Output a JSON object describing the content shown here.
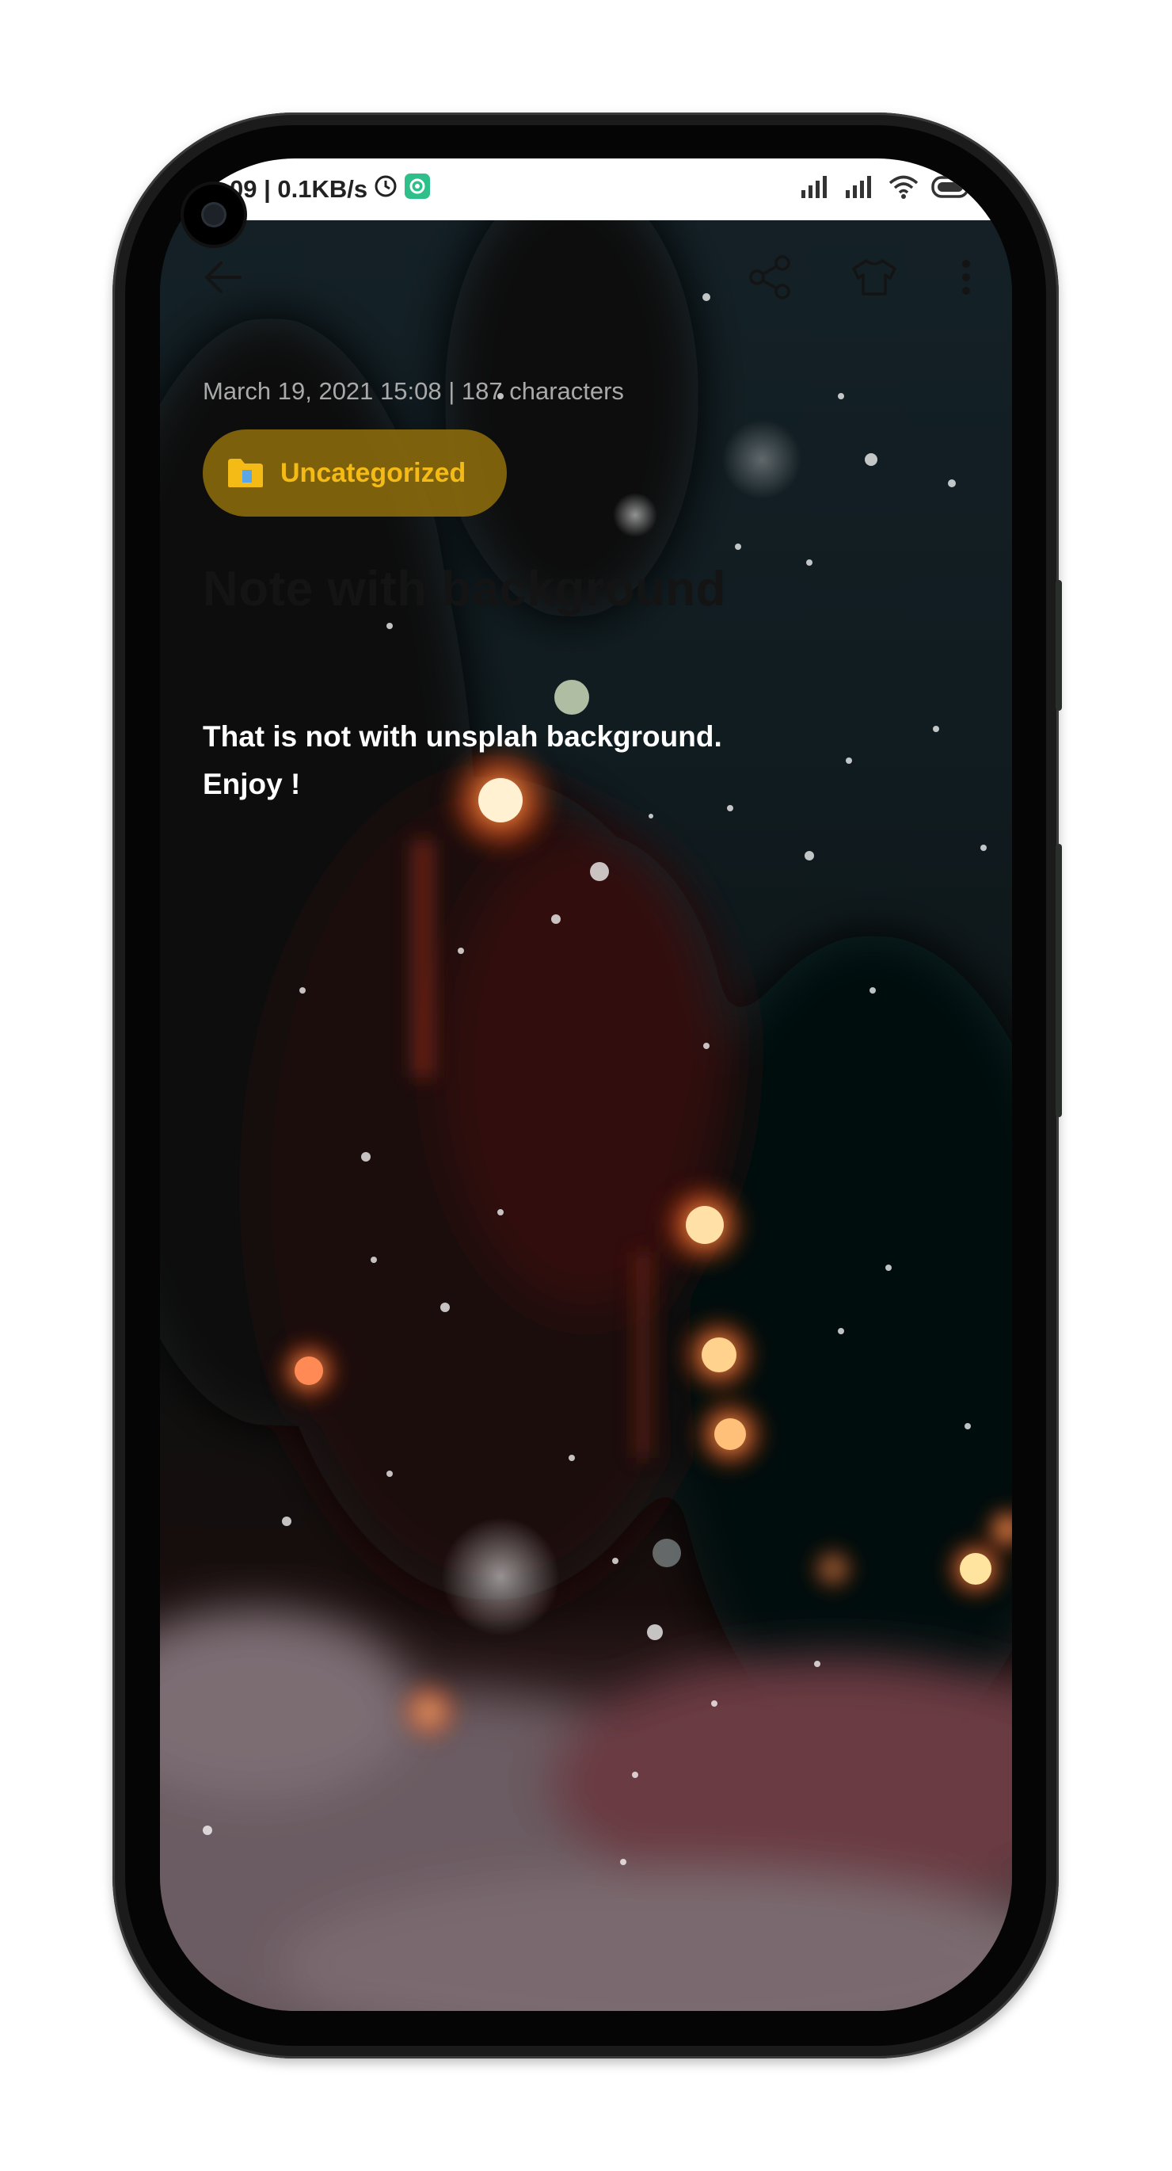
{
  "status_bar": {
    "time_speed": "09 | 0.1KB/s",
    "icons": [
      "alarm-clock-icon",
      "app-notification-icon",
      "signal-icon",
      "signal-icon",
      "wifi-icon",
      "battery-icon"
    ]
  },
  "toolbar": {
    "back_icon": "arrow-left-icon",
    "share_icon": "share-icon",
    "theme_icon": "shirt-icon",
    "more_icon": "more-vertical-icon"
  },
  "note": {
    "meta": "March 19, 2021 15:08 | 187 characters",
    "category": "Uncategorized",
    "title": "Note with background",
    "body_line1": "That is not with unsplah background.",
    "body_line2": "Enjoy !"
  },
  "colors": {
    "chip_bg": "#8d6c0c",
    "chip_text": "#f4bb16",
    "body_text": "#ffffff",
    "title_text": "#141414"
  }
}
